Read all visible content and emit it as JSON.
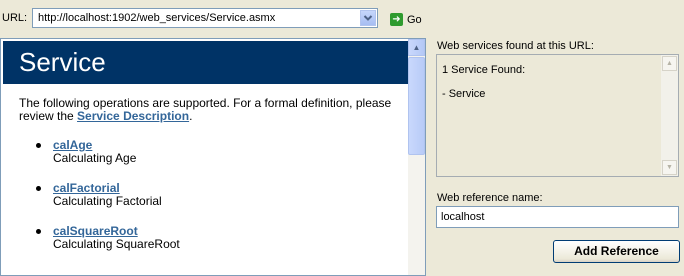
{
  "toolbar": {
    "url_label": "URL:",
    "url_value": "http://localhost:1902/web_services/Service.asmx",
    "go_label": "Go"
  },
  "browser": {
    "heading": "Service",
    "intro_before": "The following operations are supported. For a formal definition, please review the ",
    "intro_link": "Service Description",
    "intro_after": ".",
    "operations": [
      {
        "name": "calAge",
        "description": "Calculating Age"
      },
      {
        "name": "calFactorial",
        "description": "Calculating Factorial"
      },
      {
        "name": "calSquareRoot",
        "description": "Calculating SquareRoot"
      }
    ]
  },
  "side": {
    "found_label": "Web services found at this URL:",
    "found_count": "1 Service Found:",
    "found_service": "- Service",
    "webref_label": "Web reference name:",
    "webref_value": "localhost",
    "add_button": "Add Reference"
  },
  "colors": {
    "heading_bg": "#003366",
    "link": "#336699",
    "window_bg": "#ece9d8"
  },
  "icons": {
    "go": "green-arrow-icon",
    "dropdown": "chevron-down-icon"
  }
}
